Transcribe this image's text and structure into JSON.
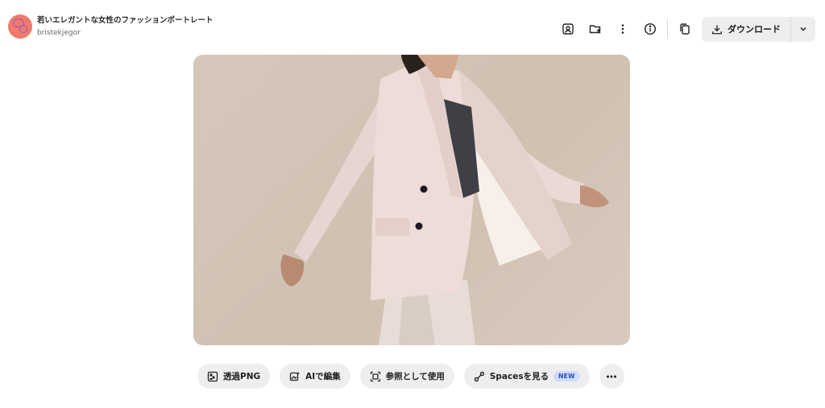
{
  "header": {
    "title": "若いエレガントな女性のファッションポートレート",
    "username": "bristekjegor",
    "download_label": "ダウンロード"
  },
  "header_icons": [
    "collection-user-icon",
    "folder-add-icon",
    "more-vertical-icon",
    "info-icon",
    "copy-icon"
  ],
  "toolbar": {
    "transparent_png": "透過PNG",
    "edit_ai": "AIで編集",
    "use_reference": "参照として使用",
    "spaces": "Spacesを見る",
    "new_badge": "NEW"
  },
  "colors": {
    "avatar": "#f27a6b",
    "button_bg": "#eeeeee",
    "badge_bg": "#cfdcff",
    "badge_text": "#2e4bb8",
    "photo_bg": "#d3c6b8"
  }
}
